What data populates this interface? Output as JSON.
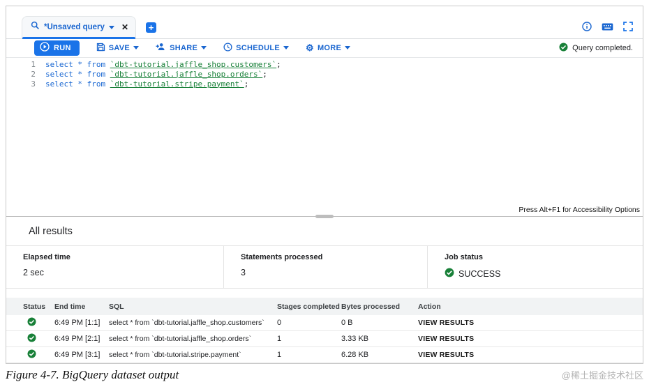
{
  "window": {
    "tab": {
      "label": "*Unsaved query"
    },
    "add_tab_label": "+"
  },
  "toolbar": {
    "run_label": "RUN",
    "save_label": "SAVE",
    "share_label": "SHARE",
    "schedule_label": "SCHEDULE",
    "more_label": "MORE",
    "status_text": "Query completed."
  },
  "editor": {
    "lines": [
      {
        "num": "1",
        "keyword": "select * from ",
        "ref": "`dbt-tutorial.jaffle_shop.customers`",
        "tail": ";"
      },
      {
        "num": "2",
        "keyword": "select * from ",
        "ref": "`dbt-tutorial.jaffle_shop.orders`",
        "tail": ";"
      },
      {
        "num": "3",
        "keyword": "select * from ",
        "ref": "`dbt-tutorial.stripe.payment`",
        "tail": ";"
      }
    ],
    "accessibility_hint": "Press Alt+F1 for Accessibility Options"
  },
  "results": {
    "title": "All results",
    "stats": [
      {
        "label": "Elapsed time",
        "value": "2 sec"
      },
      {
        "label": "Statements processed",
        "value": "3"
      },
      {
        "label": "Job status",
        "value": "SUCCESS"
      }
    ],
    "table": {
      "headers": [
        "Status",
        "End time",
        "SQL",
        "Stages completed",
        "Bytes processed",
        "Action"
      ],
      "rows": [
        {
          "end_time": "6:49 PM [1:1]",
          "sql": "select * from `dbt-tutorial.jaffle_shop.customers`",
          "stages": "0",
          "bytes": "0 B",
          "action": "VIEW RESULTS"
        },
        {
          "end_time": "6:49 PM [2:1]",
          "sql": "select * from `dbt-tutorial.jaffle_shop.orders`",
          "stages": "1",
          "bytes": "3.33 KB",
          "action": "VIEW RESULTS"
        },
        {
          "end_time": "6:49 PM [3:1]",
          "sql": "select * from `dbt-tutorial.stripe.payment`",
          "stages": "1",
          "bytes": "6.28 KB",
          "action": "VIEW RESULTS"
        }
      ]
    }
  },
  "colors": {
    "accent": "#1a73e8",
    "success": "#188038"
  },
  "caption": "Figure 4-7. BigQuery dataset output",
  "watermark": "@稀土掘金技术社区"
}
